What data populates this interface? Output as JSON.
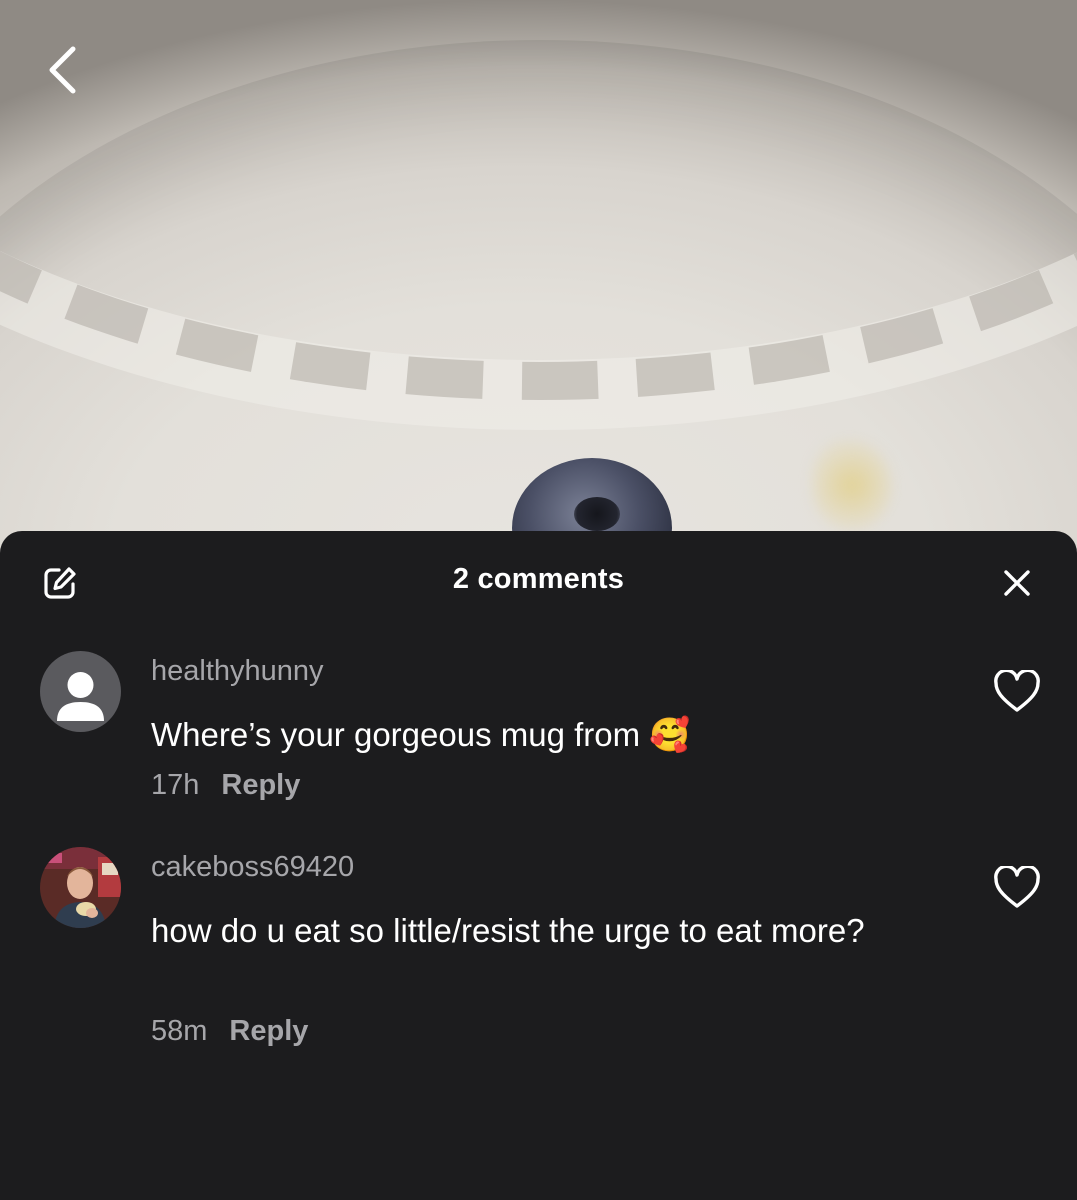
{
  "header": {
    "title": "2 comments",
    "compose_icon": "edit-icon",
    "close_icon": "close-icon"
  },
  "navigation": {
    "back_icon": "chevron-left-icon"
  },
  "comments": [
    {
      "username": "healthyhunny",
      "text": "Where’s your gorgeous mug from 🥰",
      "time": "17h",
      "reply_label": "Reply",
      "avatar": "default-avatar",
      "like_icon": "heart-outline-icon"
    },
    {
      "username": "cakeboss69420",
      "text": "how do u eat so little/resist the urge to eat more?",
      "time": "58m",
      "reply_label": "Reply",
      "avatar": "photo-avatar",
      "like_icon": "heart-outline-icon"
    }
  ],
  "colors": {
    "sheet_background": "#1c1c1e",
    "primary_text": "#ffffff",
    "secondary_text": "#a6a6aa",
    "default_avatar": "#5a5a5e"
  }
}
